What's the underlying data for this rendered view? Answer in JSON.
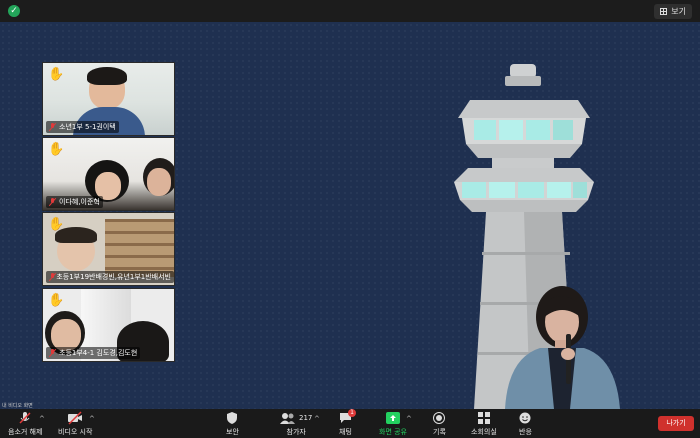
{
  "top_bar": {
    "view_label": "보기"
  },
  "participants": [
    {
      "name": "소년1부 5-1권이택",
      "hand": "✋"
    },
    {
      "name": "이다혜,이준혁",
      "hand": "✋"
    },
    {
      "name": "초등1부19반배경빈,유년1부1반배서빈",
      "hand": "✋"
    },
    {
      "name": "초등1부4-1 김도경,김도현",
      "hand": "✋"
    }
  ],
  "self_view_label": "내 비디오 화면",
  "toolbar": {
    "unmute_label": "음소거 해제",
    "video_label": "비디오 시작",
    "security_label": "보안",
    "participants_label": "참가자",
    "participants_count": "217",
    "chat_label": "채팅",
    "chat_badge": "1",
    "share_label": "화면 공유",
    "record_label": "기록",
    "breakout_label": "소회의실",
    "reactions_label": "반응",
    "leave_label": "나가기"
  },
  "colors": {
    "share_green": "#23d160",
    "leave_red": "#d0312d",
    "stage_bg": "#1f3050"
  }
}
